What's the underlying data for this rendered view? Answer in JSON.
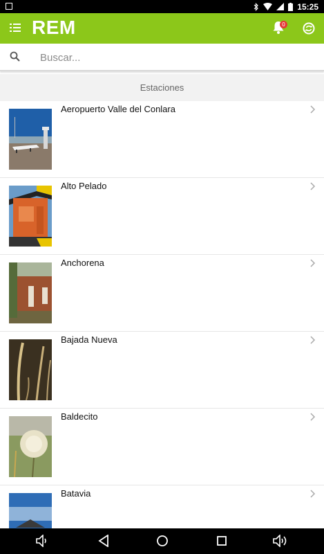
{
  "status_bar": {
    "time": "15:25"
  },
  "app_bar": {
    "title": "REM",
    "notification_count": "0"
  },
  "search": {
    "placeholder": "Buscar..."
  },
  "section": {
    "title": "Estaciones"
  },
  "stations": [
    {
      "name": "Aeropuerto Valle del Conlara",
      "thumb": "airport-photo"
    },
    {
      "name": "Alto Pelado",
      "thumb": "station-box-photo"
    },
    {
      "name": "Anchorena",
      "thumb": "brick-house-photo"
    },
    {
      "name": "Bajada Nueva",
      "thumb": "grass-photo"
    },
    {
      "name": "Baldecito",
      "thumb": "dandelion-photo"
    },
    {
      "name": "Batavia",
      "thumb": "sky-roof-photo"
    }
  ],
  "colors": {
    "appbar": "#8cc71a",
    "badge": "#e53935"
  }
}
